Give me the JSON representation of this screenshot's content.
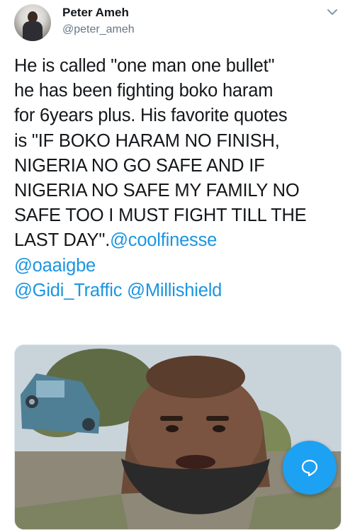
{
  "author": {
    "display_name": "Peter Ameh",
    "handle": "@peter_ameh",
    "avatar_icon": "profile-avatar"
  },
  "tweet": {
    "lines": [
      "He is called \"one man one bullet\"",
      "he has been fighting boko haram",
      "for 6years plus. His favorite quotes",
      "is \"IF BOKO HARAM NO FINISH,",
      "NIGERIA NO GO SAFE AND IF",
      "NIGERIA NO SAFE MY FAMILY NO",
      "SAFE TOO I MUST FIGHT TILL THE",
      "LAST DAY\"."
    ],
    "mentions": [
      "@coolfinesse",
      "@oaaigbe",
      "@Gidi_Traffic",
      "@Millishield"
    ]
  },
  "icons": {
    "menu": "chevron-down-icon",
    "compose": "chat-bubble-icon"
  },
  "colors": {
    "accent": "#1da1f2",
    "mention": "#1b95e0",
    "text": "#14171a",
    "secondary": "#657786"
  }
}
